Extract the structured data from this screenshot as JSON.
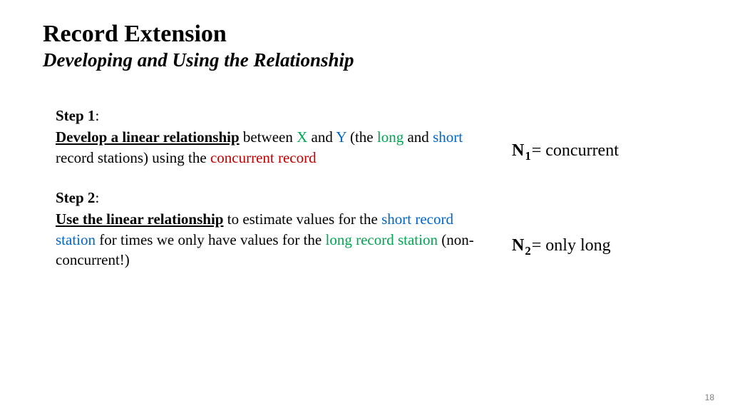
{
  "title": "Record Extension",
  "subtitle": "Developing and Using the Relationship",
  "step1": {
    "label": "Step 1",
    "develop": "Develop a linear relationship",
    "between": " between ",
    "x": "X",
    "and": " and ",
    "y": "Y",
    "the_open": " (the ",
    "long": "long",
    "mid": " and ",
    "short": "short",
    "stations": " record stations) using the ",
    "concurrent": "concurrent record"
  },
  "step2": {
    "label": "Step 2",
    "use": "Use the linear relationship",
    "estimate": " to estimate values for the ",
    "short_station": "short record station",
    "times": " for times we only have values for the ",
    "long_station": "long record station",
    "nonconc": " (non-concurrent!)"
  },
  "n1": {
    "n": "N",
    "sub": "1",
    "eq": " = concurrent"
  },
  "n2": {
    "n": "N",
    "sub": "2",
    "eq": " = only long"
  },
  "page": "18",
  "colon": ":"
}
